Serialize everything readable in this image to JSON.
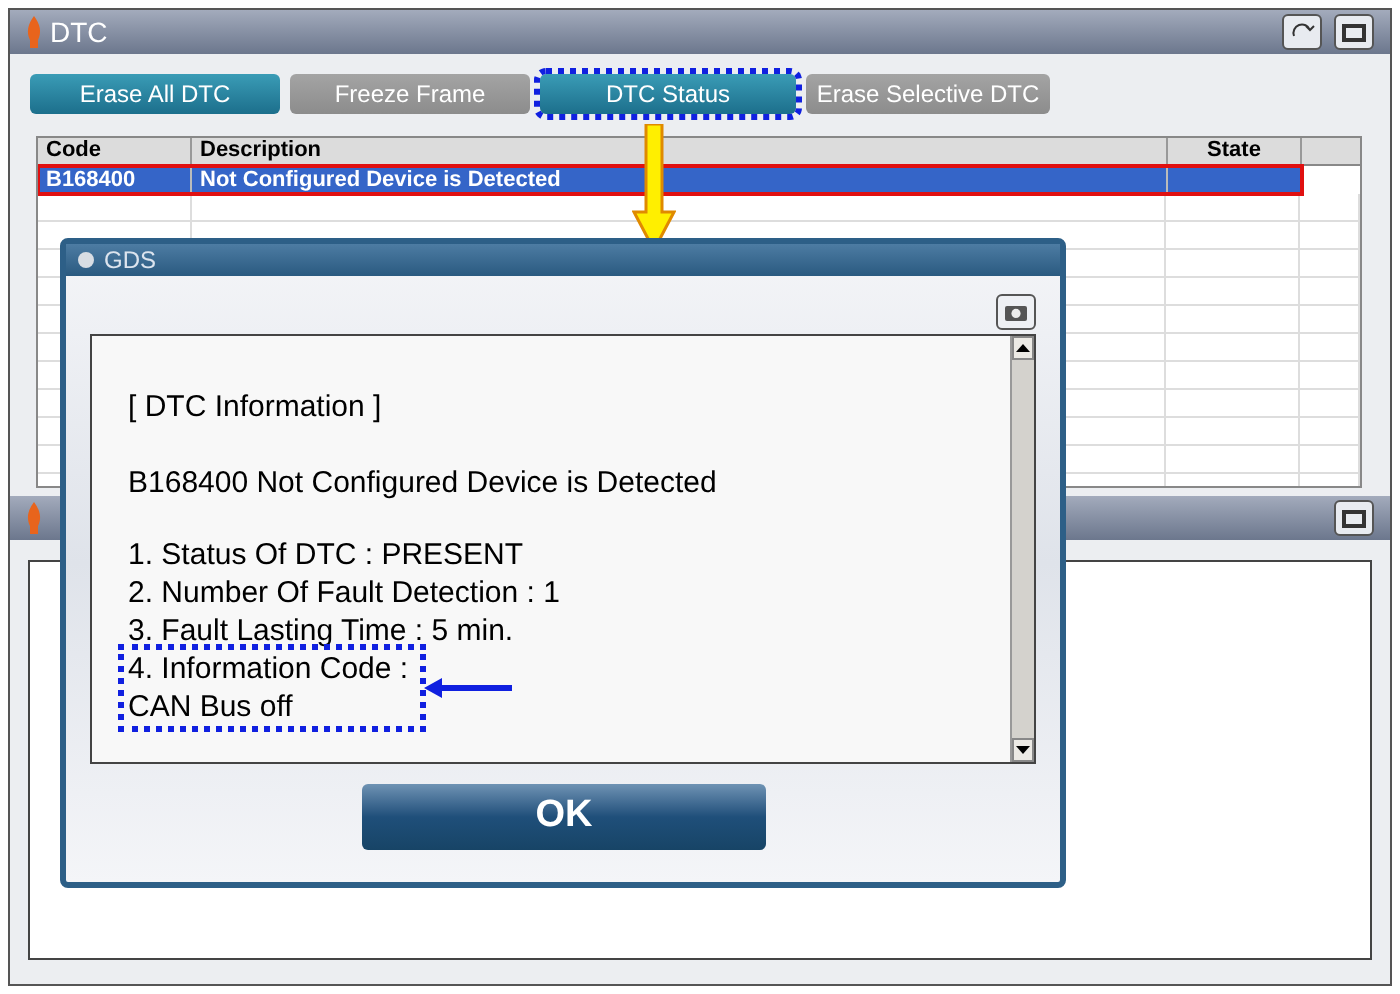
{
  "window": {
    "title": "DTC"
  },
  "buttons": [
    {
      "label": "Erase All DTC",
      "disabled": false,
      "highlighted": false
    },
    {
      "label": "Freeze Frame",
      "disabled": true,
      "highlighted": false
    },
    {
      "label": "DTC Status",
      "disabled": false,
      "highlighted": true
    },
    {
      "label": "Erase Selective DTC",
      "disabled": true,
      "highlighted": false
    }
  ],
  "table": {
    "columns": [
      "Code",
      "Description",
      "State"
    ],
    "rows": [
      {
        "code": "B168400",
        "description": "Not Configured Device is Detected",
        "selected": true
      }
    ]
  },
  "dialog": {
    "title": "GDS",
    "heading": "[ DTC Information ]",
    "summary": "B168400 Not Configured Device is Detected",
    "lines": [
      {
        "text": "1. Status Of DTC : PRESENT",
        "highlighted": false
      },
      {
        "text": "2. Number Of Fault Detection : 1",
        "highlighted": false
      },
      {
        "text": "3. Fault Lasting Time : 5 min.",
        "highlighted": false
      },
      {
        "text": "4. Information Code :",
        "highlighted": true
      },
      {
        "text": "CAN Bus off",
        "highlighted": true
      }
    ],
    "button": "OK"
  }
}
